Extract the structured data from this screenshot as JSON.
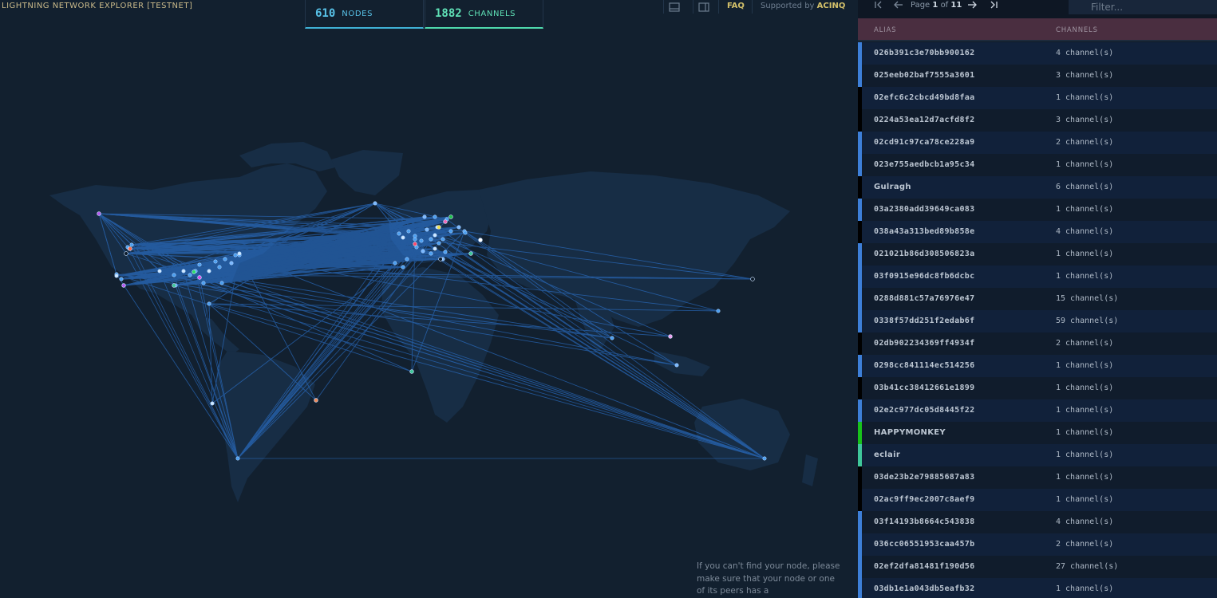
{
  "header": {
    "title": "LIGHTNING NETWORK EXPLORER [TESTNET]",
    "nodes_count": "610",
    "nodes_label": "NODES",
    "channels_count": "1882",
    "channels_label": "CHANNELS",
    "faq_label": "FAQ",
    "supported_prefix": "Supported by",
    "supported_brand": "ACINQ"
  },
  "help_text": "If you can't find your node, please make sure that your node or one of its peers has a",
  "pager": {
    "page_word": "Page",
    "current_page": "1",
    "of_word": "of",
    "total_pages": "11"
  },
  "filter": {
    "placeholder": "Filter..."
  },
  "table": {
    "alias_header": "ALIAS",
    "channels_header": "CHANNELS",
    "rows": [
      {
        "alias": "026b391c3e70bb900162",
        "channels": "4 channel(s)",
        "color": "#3d7fd8"
      },
      {
        "alias": "025eeb02baf7555a3601",
        "channels": "3 channel(s)",
        "color": "#3d7fd8"
      },
      {
        "alias": "02efc6c2cbcd49bd8faa",
        "channels": "1 channel(s)",
        "color": "#000000"
      },
      {
        "alias": "0224a53ea12d7acfd8f2",
        "channels": "3 channel(s)",
        "color": "#000000"
      },
      {
        "alias": "02cd91c97ca78ce228a9",
        "channels": "2 channel(s)",
        "color": "#3d7fd8"
      },
      {
        "alias": "023e755aedbcb1a95c34",
        "channels": "1 channel(s)",
        "color": "#3d7fd8"
      },
      {
        "alias": "Gulragh",
        "channels": "6 channel(s)",
        "color": "#000000"
      },
      {
        "alias": "03a2380add39649ca083",
        "channels": "1 channel(s)",
        "color": "#3d7fd8"
      },
      {
        "alias": "038a43a313bed89b858e",
        "channels": "4 channel(s)",
        "color": "#000000"
      },
      {
        "alias": "021021b86d308506823a",
        "channels": "1 channel(s)",
        "color": "#3d7fd8"
      },
      {
        "alias": "03f0915e96dc8fb6dcbc",
        "channels": "1 channel(s)",
        "color": "#3d7fd8"
      },
      {
        "alias": "0288d881c57a76976e47",
        "channels": "15 channel(s)",
        "color": "#3d7fd8"
      },
      {
        "alias": "0338f57dd251f2edab6f",
        "channels": "59 channel(s)",
        "color": "#3d7fd8"
      },
      {
        "alias": "02db902234369ff4934f",
        "channels": "2 channel(s)",
        "color": "#000000"
      },
      {
        "alias": "0298cc841114ec514256",
        "channels": "1 channel(s)",
        "color": "#3d7fd8"
      },
      {
        "alias": "03b41cc38412661e1899",
        "channels": "1 channel(s)",
        "color": "#000000"
      },
      {
        "alias": "02e2c977dc05d8445f22",
        "channels": "1 channel(s)",
        "color": "#3d7fd8"
      },
      {
        "alias": "HAPPYMONKEY",
        "channels": "1 channel(s)",
        "color": "#18c21b"
      },
      {
        "alias": "eclair",
        "channels": "1 channel(s)",
        "color": "#3fc79a"
      },
      {
        "alias": "03de23b2e79885687a83",
        "channels": "1 channel(s)",
        "color": "#000000"
      },
      {
        "alias": "02ac9ff9ec2007c8aef9",
        "channels": "1 channel(s)",
        "color": "#000000"
      },
      {
        "alias": "03f14193b8664c543838",
        "channels": "4 channel(s)",
        "color": "#3d7fd8"
      },
      {
        "alias": "036cc06551953caa457b",
        "channels": "2 channel(s)",
        "color": "#3d7fd8"
      },
      {
        "alias": "02ef2dfa81481f190d56",
        "channels": "27 channel(s)",
        "color": "#3d7fd8"
      },
      {
        "alias": "03db1e1a043db5eafb32",
        "channels": "1 channel(s)",
        "color": "#3d7fd8"
      }
    ]
  },
  "colors": {
    "map_bg": "#12202f",
    "land": "#18304a",
    "channel_line": "#2f7fe6",
    "node": "#4a9ef0"
  }
}
